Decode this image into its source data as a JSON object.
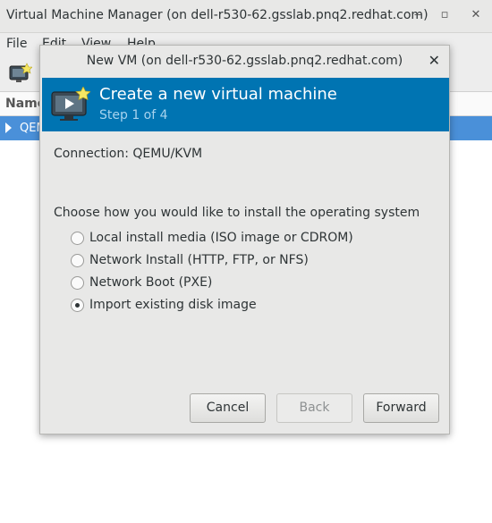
{
  "main_window": {
    "title": "Virtual Machine Manager (on dell-r530-62.gsslab.pnq2.redhat.com)",
    "wm_buttons": {
      "minimize": "‒",
      "maximize": "▫",
      "close": "✕"
    },
    "menu": [
      "File",
      "Edit",
      "View",
      "Help"
    ],
    "list": {
      "column_header": "Name",
      "rows": [
        "QEMU/KVM"
      ]
    }
  },
  "dialog": {
    "title": "New VM (on dell-r530-62.gsslab.pnq2.redhat.com)",
    "close_glyph": "✕",
    "header_title": "Create a new virtual machine",
    "header_step": "Step 1 of 4",
    "connection_label": "Connection:",
    "connection_value": "QEMU/KVM",
    "install_prompt": "Choose how you would like to install the operating system",
    "install_options": [
      {
        "label": "Local install media (ISO image or CDROM)",
        "selected": false
      },
      {
        "label": "Network Install (HTTP, FTP, or NFS)",
        "selected": false
      },
      {
        "label": "Network Boot (PXE)",
        "selected": false
      },
      {
        "label": "Import existing disk image",
        "selected": true
      }
    ],
    "buttons": {
      "cancel": "Cancel",
      "back": "Back",
      "forward": "Forward"
    }
  },
  "colors": {
    "banner": "#0074b2",
    "selection": "#4a90d9"
  },
  "icons": [
    "new-vm-icon",
    "monitor-star-icon",
    "expander-icon"
  ]
}
